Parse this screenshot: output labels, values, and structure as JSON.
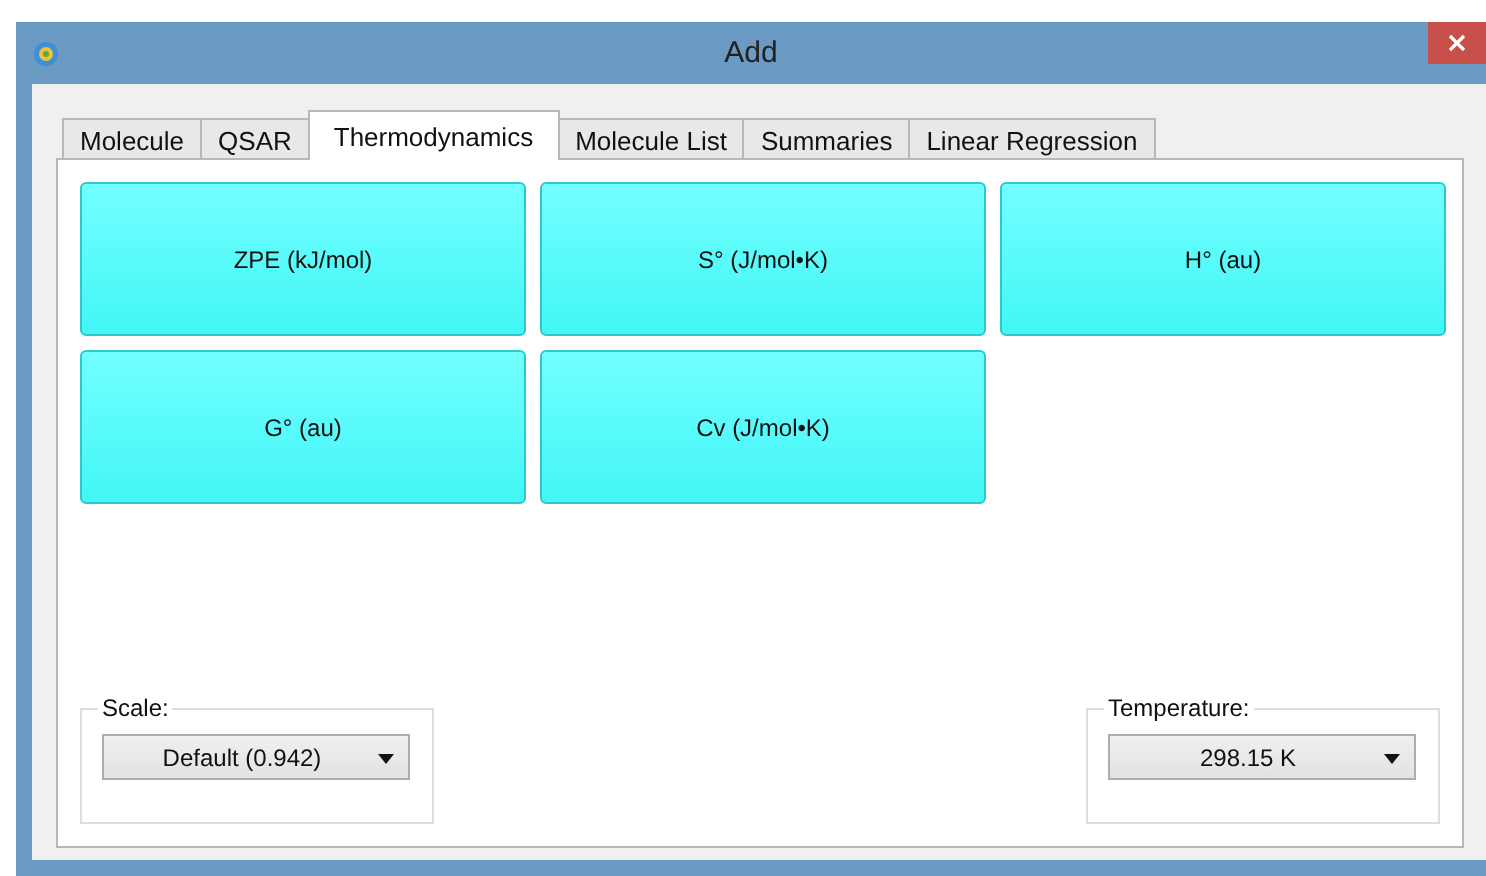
{
  "window": {
    "title": "Add"
  },
  "tabs": [
    {
      "label": "Molecule",
      "selected": false
    },
    {
      "label": "QSAR",
      "selected": false
    },
    {
      "label": "Thermodynamics",
      "selected": true
    },
    {
      "label": "Molecule List",
      "selected": false
    },
    {
      "label": "Summaries",
      "selected": false
    },
    {
      "label": "Linear Regression",
      "selected": false
    }
  ],
  "property_buttons": [
    {
      "label": "ZPE (kJ/mol)"
    },
    {
      "label": "S° (J/mol•K)"
    },
    {
      "label": "H° (au)"
    },
    {
      "label": "G° (au)"
    },
    {
      "label": "Cv (J/mol•K)"
    }
  ],
  "scale": {
    "label": "Scale:",
    "value": "Default (0.942)"
  },
  "temperature": {
    "label": "Temperature:",
    "value": "298.15 K"
  }
}
